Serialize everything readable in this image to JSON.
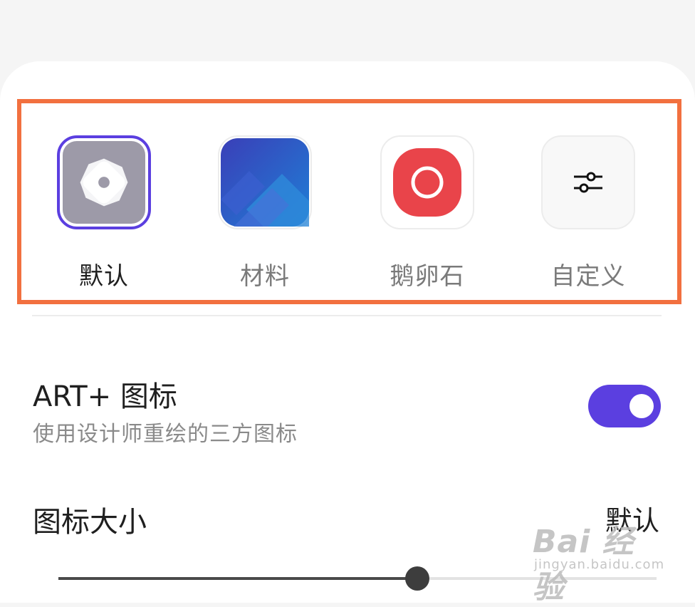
{
  "icon_styles": [
    {
      "label": "默认",
      "icon": "gear-icon",
      "selected": true
    },
    {
      "label": "材料",
      "icon": "material-icon",
      "selected": false
    },
    {
      "label": "鹅卵石",
      "icon": "pebble-icon",
      "selected": false
    },
    {
      "label": "自定义",
      "icon": "sliders-icon",
      "selected": false
    }
  ],
  "art_plus": {
    "title": "ART+ 图标",
    "subtitle": "使用设计师重绘的三方图标",
    "enabled": true
  },
  "icon_size": {
    "title": "图标大小",
    "value": "默认",
    "slider_fraction": 0.6
  },
  "watermark": {
    "main": "Bai 经验",
    "sub": "jingyan.baidu.com"
  },
  "colors": {
    "accent": "#5b3fe0",
    "highlight_frame": "#f2703f",
    "pebble_red": "#e9444a",
    "material_blue": "#3050c0"
  }
}
